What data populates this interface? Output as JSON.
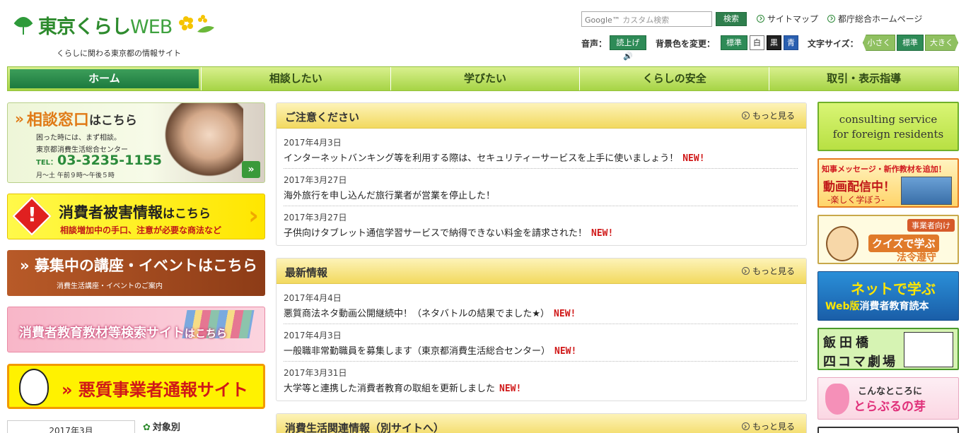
{
  "header": {
    "logo_main": "東京くらし",
    "logo_web": "WEB",
    "tagline": "くらしに関わる東京都の情報サイト",
    "search_placeholder": "カスタム検索",
    "search_button": "検索",
    "sitemap_link": "サイトマップ",
    "gov_link": "都庁総合ホームページ",
    "voice_label": "音声：",
    "voice_button": "読上げ",
    "bgcolor_label": "背景色を変更：",
    "bg_standard": "標準",
    "bg_white": "白",
    "bg_black": "黒",
    "bg_blue": "青",
    "fontsize_label": "文字サイズ：",
    "size_small": "小さく",
    "size_standard": "標準",
    "size_large": "大きく"
  },
  "nav": {
    "items": [
      "ホーム",
      "相談したい",
      "学びたい",
      "くらしの安全",
      "取引・表示指導"
    ]
  },
  "left": {
    "consult": {
      "title_main": "相談窓口",
      "title_suffix": "はこちら",
      "line1": "困った時には、まず相談。",
      "line2": "東京都消費生活総合センター",
      "tel_prefix": "TEL：",
      "tel": "03-3235-1155",
      "hours": "月～土 午前９時～午後５時"
    },
    "damage": {
      "title_main": "消費者被害情報",
      "title_suffix": "はこちら",
      "subtitle": "相談増加中の手口、注意が必要な商法など"
    },
    "events": {
      "title": "募集中の講座・イベントはこちら",
      "subtitle": "消費生活講座・イベントのご案内"
    },
    "materials": {
      "title": "消費者教育教材等検索サイト",
      "suffix": "はこちら"
    },
    "report": {
      "title": "悪質事業者通報サイト"
    },
    "date_tab": "2017年3月",
    "target": "対象別"
  },
  "panels": {
    "caution": {
      "title": "ご注意ください",
      "more": "もっと見る",
      "items": [
        {
          "date": "2017年4月3日",
          "text": "インターネットバンキング等を利用する際は、セキュリティーサービスを上手に使いましょう！",
          "badge": "NEW!"
        },
        {
          "date": "2017年3月27日",
          "text": "海外旅行を申し込んだ旅行業者が営業を停止した！",
          "badge": ""
        },
        {
          "date": "2017年3月27日",
          "text": "子供向けタブレット通信学習サービスで納得できない料金を請求された！",
          "badge": "NEW!"
        }
      ]
    },
    "latest": {
      "title": "最新情報",
      "more": "もっと見る",
      "items": [
        {
          "date": "2017年4月4日",
          "text": "悪質商法ネタ動画公開継続中！（ネタバトルの結果でました★）",
          "badge": "NEW!"
        },
        {
          "date": "2017年4月3日",
          "text": "一般職非常勤職員を募集します（東京都消費生活総合センター）",
          "badge": "NEW!"
        },
        {
          "date": "2017年3月31日",
          "text": "大学等と連携した消費者教育の取組を更新しました",
          "badge": "NEW!"
        }
      ]
    },
    "related": {
      "title": "消費生活関連情報（別サイトへ）",
      "more": "もっと見る"
    }
  },
  "right": {
    "foreign_line1": "consulting service",
    "foreign_line2": "for foreign residents",
    "video_top": "知事メッセージ・新作教材を追加！",
    "video_main": "動画配信中！",
    "video_sub": "-楽しく学ぼう-",
    "quiz_tag": "事業者向け",
    "quiz_main": "クイズで学ぶ",
    "quiz_sub": "法令遵守",
    "net_main": "ネットで学ぶ",
    "net_web": "Web版",
    "net_sub": "消費者教育読本",
    "iidabashi_1": "飯田橋",
    "iidabashi_2": "四コマ劇場",
    "torabu_1": "こんなところに",
    "torabu_2": "とらぶるの芽"
  }
}
